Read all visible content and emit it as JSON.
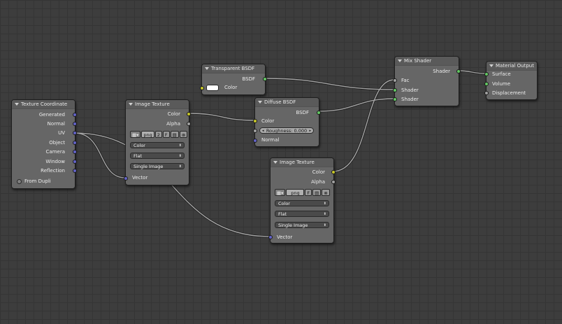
{
  "colors": {
    "socket_vector": "#6363c7",
    "socket_color": "#c7c729",
    "socket_float": "#a1a1a1",
    "socket_shader": "#63c763",
    "wire": "#9a9a9a"
  },
  "texture_coordinate": {
    "title": "Texture Coordinate",
    "outputs": [
      "Generated",
      "Normal",
      "UV",
      "Object",
      "Camera",
      "Window",
      "Reflection"
    ],
    "from_dupli": "From Dupli"
  },
  "image_texture_1": {
    "title": "Image Texture",
    "out_color": "Color",
    "out_alpha": "Alpha",
    "image_name": "png",
    "users": "2",
    "fake_user": "F",
    "color_space": "Color",
    "projection": "Flat",
    "source": "Single Image",
    "in_vector": "Vector"
  },
  "image_texture_2": {
    "title": "Image Texture",
    "out_color": "Color",
    "out_alpha": "Alpha",
    "image_name": "png",
    "fake_user": "F",
    "color_space": "Color",
    "projection": "Flat",
    "source": "Single Image",
    "in_vector": "Vector"
  },
  "transparent_bsdf": {
    "title": "Transparent BSDF",
    "out_bsdf": "BSDF",
    "in_color": "Color"
  },
  "diffuse_bsdf": {
    "title": "Diffuse BSDF",
    "out_bsdf": "BSDF",
    "in_color": "Color",
    "roughness": "Roughness: 0.000",
    "in_normal": "Normal"
  },
  "mix_shader": {
    "title": "Mix Shader",
    "out_shader": "Shader",
    "in_fac": "Fac",
    "in_shader_1": "Shader",
    "in_shader_2": "Shader"
  },
  "material_output": {
    "title": "Material Output",
    "in_surface": "Surface",
    "in_volume": "Volume",
    "in_displacement": "Displacement"
  }
}
